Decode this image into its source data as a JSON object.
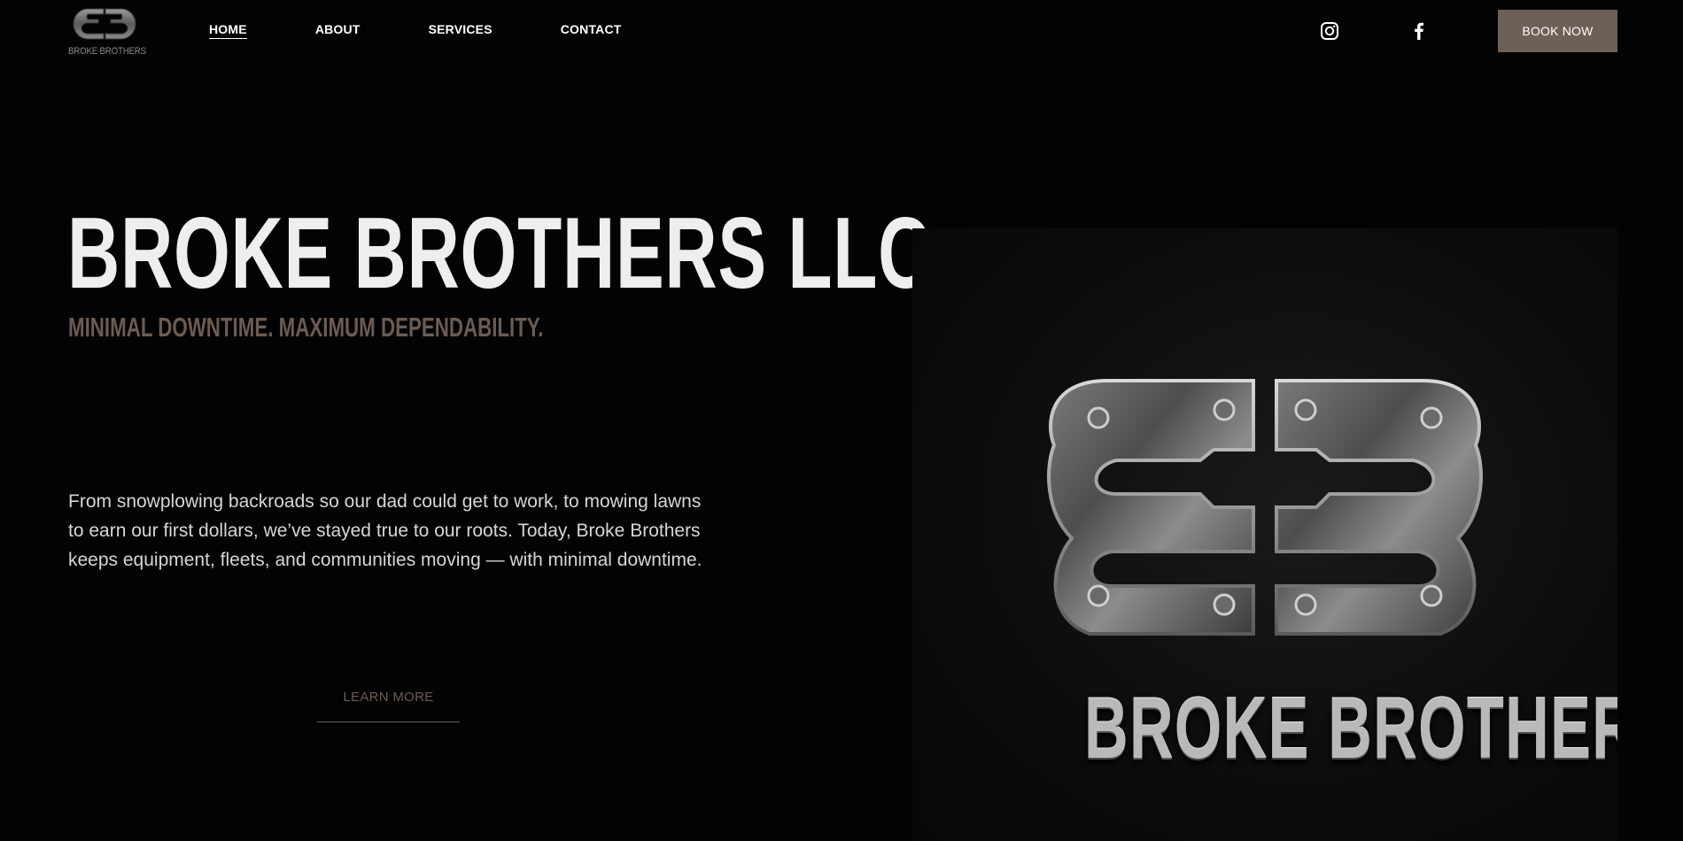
{
  "header": {
    "logo": {
      "label": "BROKE BROTHERS",
      "icon": "bb-monogram-icon"
    },
    "nav": [
      {
        "label": "HOME",
        "active": true
      },
      {
        "label": "ABOUT",
        "active": false
      },
      {
        "label": "SERVICES",
        "active": false
      },
      {
        "label": "CONTACT",
        "active": false
      }
    ],
    "social": [
      {
        "icon": "instagram-icon"
      },
      {
        "icon": "facebook-icon"
      }
    ],
    "book_label": "BOOK NOW"
  },
  "hero": {
    "title": "BROKE BROTHERS LLC",
    "subtitle": "MINIMAL DOWNTIME. MAXIMUM DEPENDABILITY.",
    "body": "From snowplowing backroads so our dad could get to work, to mowing lawns to earn our first dollars, we’ve stayed true to our roots. Today, Broke Brothers keeps equipment, fleets, and communities moving — with minimal downtime.",
    "cta_label": "LEARN MORE",
    "image": {
      "brand_text": "BROKE BROTHERS",
      "icon": "bb-metal-logo-icon"
    }
  },
  "colors": {
    "background": "#030303",
    "accent": "#6d6057",
    "accent_text": "#6b5c52",
    "title": "#eeeef0",
    "body": "#d6d6d6"
  }
}
